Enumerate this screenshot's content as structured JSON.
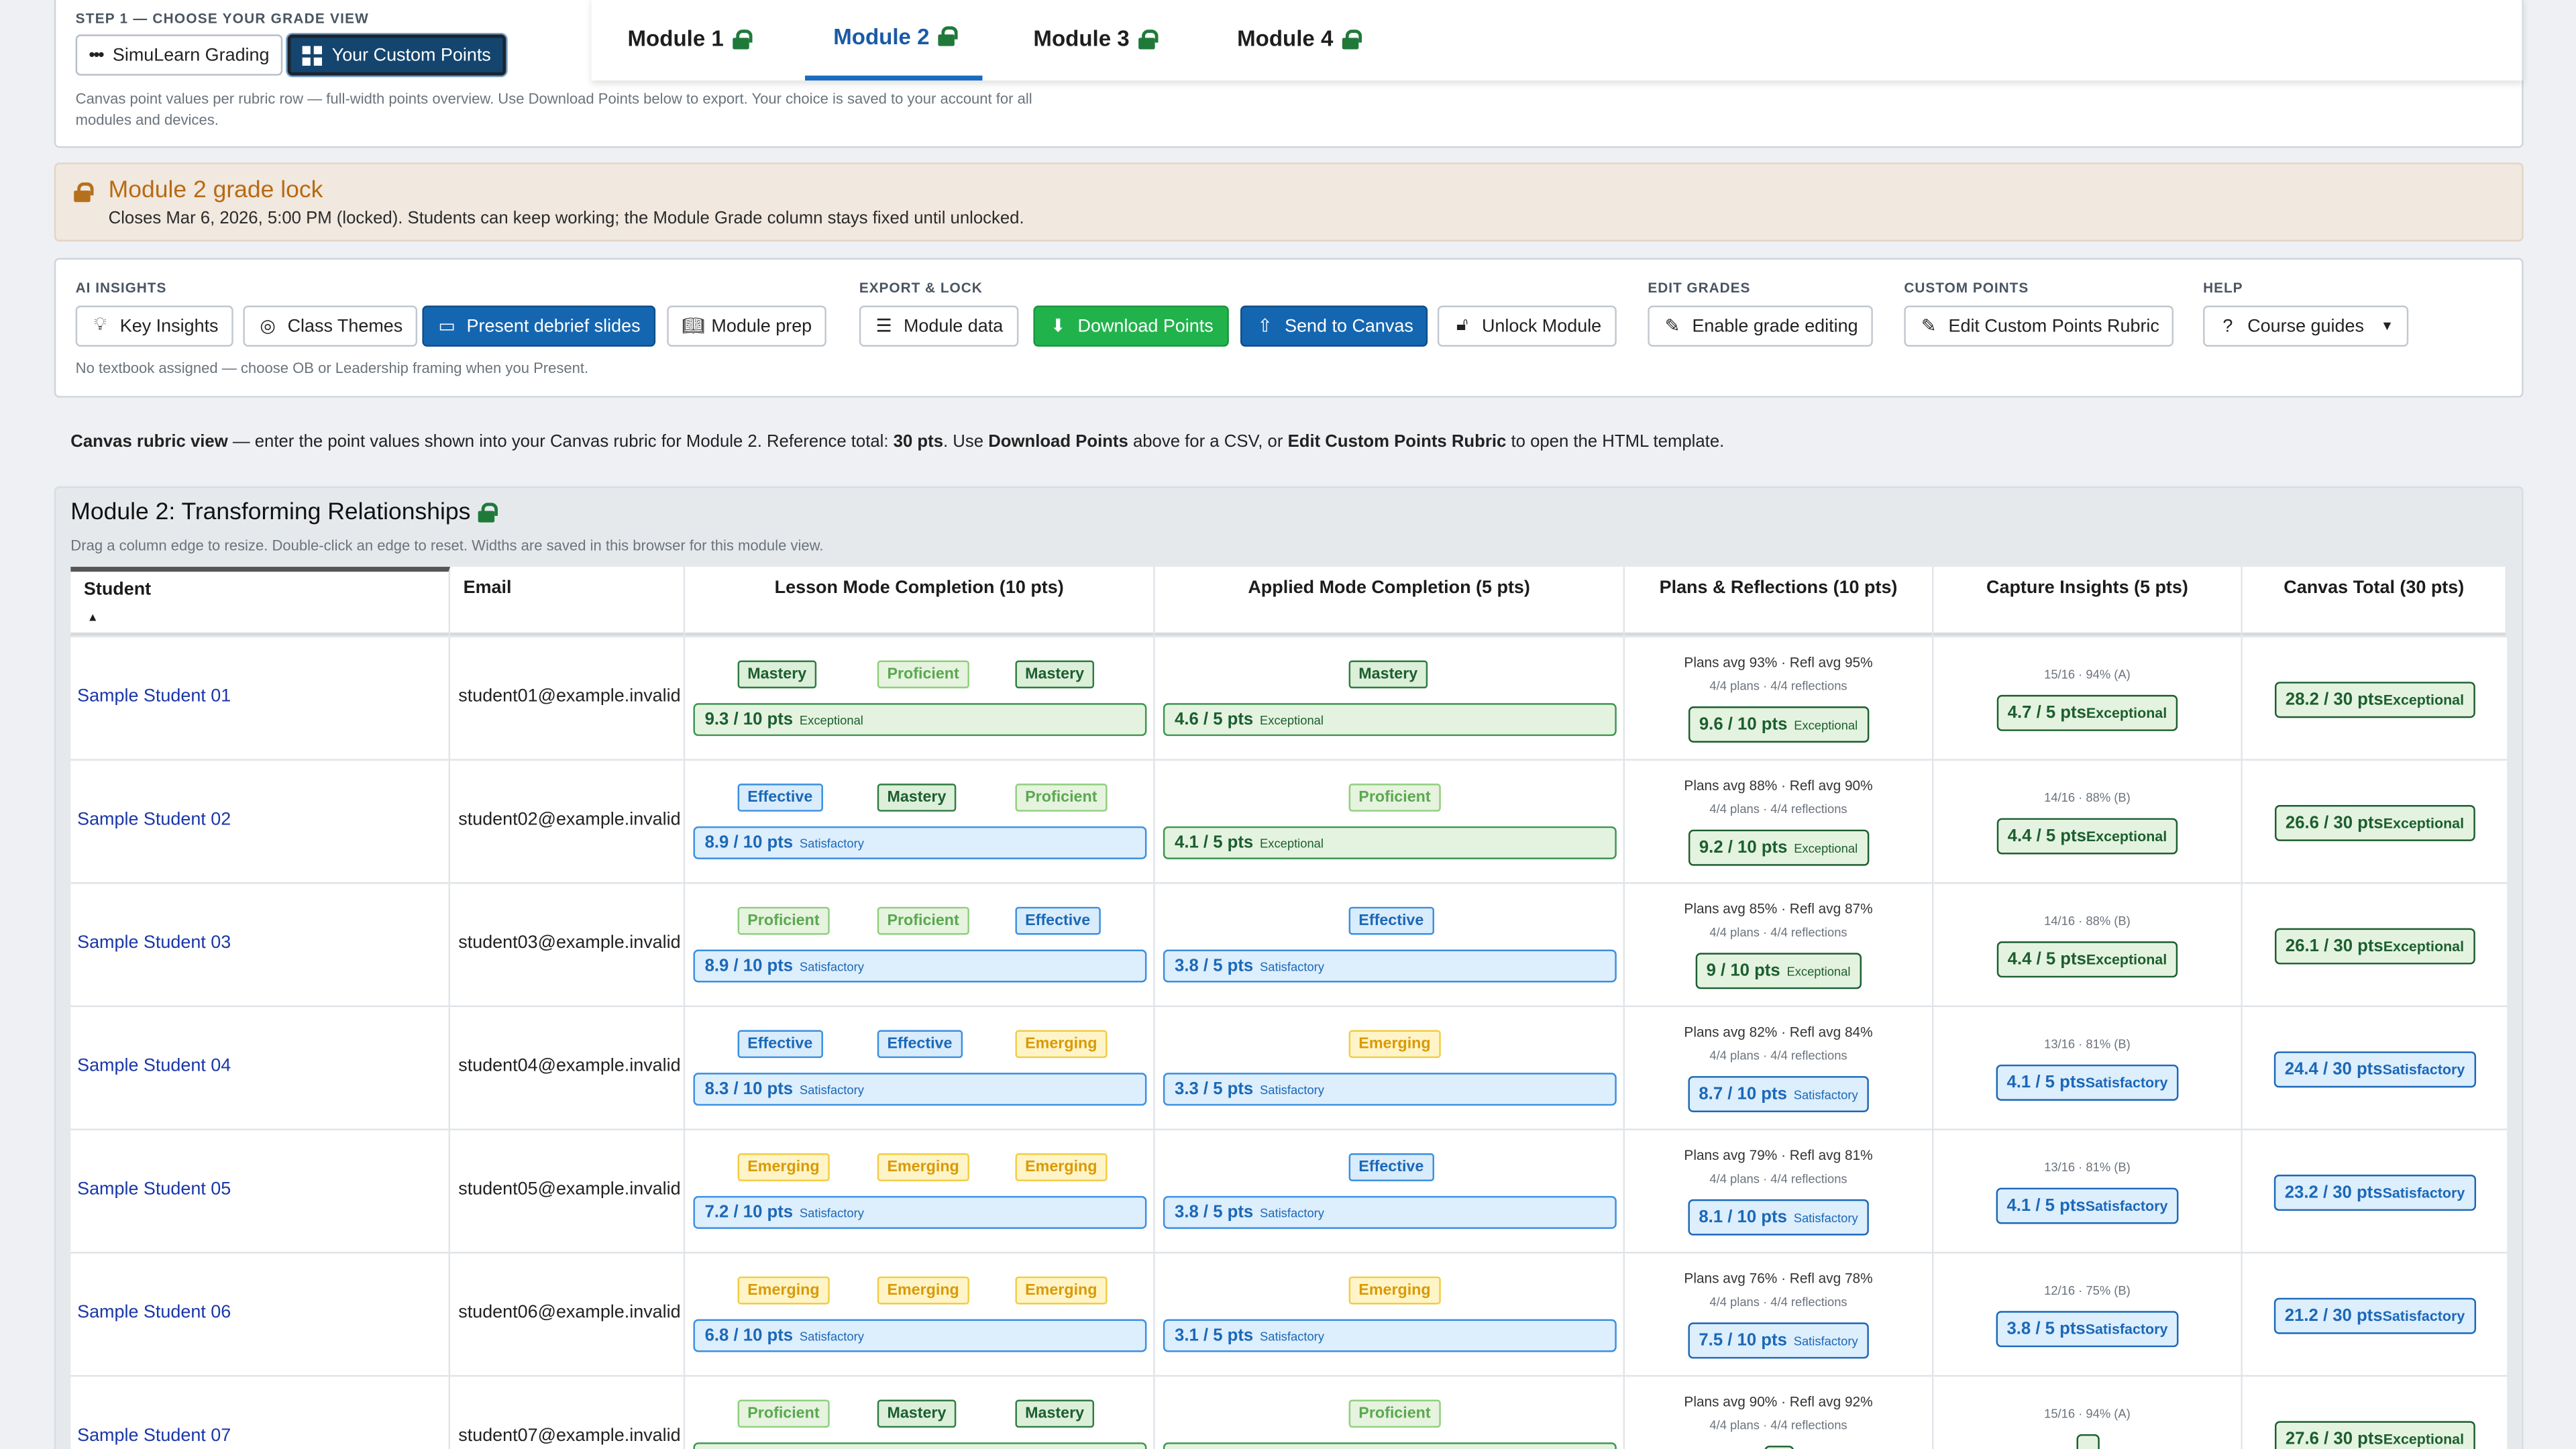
{
  "step": {
    "label": "STEP 1 — CHOOSE YOUR GRADE VIEW",
    "buttons": [
      {
        "label": "SimuLearn Grading",
        "icon": "dots-icon"
      },
      {
        "label": "Your Custom Points",
        "icon": "grid-icon",
        "selected": true
      }
    ],
    "desc": "Canvas point values per rubric row — full-width points overview. Use Download Points below to export. Your choice is saved to your account for all modules and devices."
  },
  "tabs": [
    {
      "label": "Module 1",
      "active": false
    },
    {
      "label": "Module 2",
      "active": true
    },
    {
      "label": "Module 3",
      "active": false
    },
    {
      "label": "Module 4",
      "active": false
    }
  ],
  "lock": {
    "title": "Module 2 grade lock",
    "desc": "Closes Mar 6, 2026, 5:00 PM (locked). Students can keep working; the Module Grade column stays fixed until unlocked."
  },
  "toolbar": {
    "groups": {
      "ai": "AI INSIGHTS",
      "export": "EXPORT & LOCK",
      "edit": "EDIT GRADES",
      "custom": "CUSTOM POINTS",
      "help": "HELP"
    },
    "buttons": {
      "key_insights": "Key Insights",
      "class_themes": "Class Themes",
      "present": "Present debrief slides",
      "module_prep": "Module prep",
      "module_data": "Module data",
      "download": "Download Points",
      "send": "Send to Canvas",
      "unlock": "Unlock Module",
      "enable_edit": "Enable grade editing",
      "edit_rubric": "Edit Custom Points Rubric",
      "guides": "Course guides"
    },
    "note": "No textbook assigned — choose OB or Leadership framing when you Present."
  },
  "info": {
    "p1": "Canvas rubric view",
    "p2": " — enter the point values shown into your Canvas rubric for Module 2. Reference total: ",
    "p3": "30 pts",
    "p4": ". Use ",
    "p5": "Download Points",
    "p6": " above for a CSV, or ",
    "p7": "Edit Custom Points Rubric",
    "p8": " to open the HTML template."
  },
  "module": {
    "title": "Module 2: Transforming Relationships",
    "hint": "Drag a column edge to resize. Double-click an edge to reset. Widths are saved in this browser for this module view."
  },
  "headers": {
    "student": "Student",
    "email": "Email",
    "lesson": "Lesson Mode Completion (10 pts)",
    "applied": "Applied Mode Completion (5 pts)",
    "plans": "Plans & Reflections (10 pts)",
    "capture": "Capture Insights (5 pts)",
    "total": "Canvas Total (30 pts)"
  },
  "rows": [
    {
      "name": "Sample Student 01",
      "email": "student01@example.invalid",
      "lesson_badges": [
        "Mastery",
        "Proficient",
        "Mastery"
      ],
      "lesson_pts": "9.3 / 10 pts",
      "lesson_tier": "Exceptional",
      "applied_badge": "Mastery",
      "applied_pts": "4.6 / 5 pts",
      "applied_tier": "Exceptional",
      "plans_avg": "Plans avg 93% · Refl avg 95%",
      "plans_counts": "4/4 plans · 4/4 reflections",
      "plans_pts": "9.6 / 10 pts",
      "plans_tier": "Exceptional",
      "capture_info": "15/16 · 94% (A)",
      "capture_pts": "4.7 / 5 pts",
      "capture_tier": "Exceptional",
      "total_pts": "28.2 / 30 pts",
      "total_tier": "Exceptional"
    },
    {
      "name": "Sample Student 02",
      "email": "student02@example.invalid",
      "lesson_badges": [
        "Effective",
        "Mastery",
        "Proficient"
      ],
      "lesson_pts": "8.9 / 10 pts",
      "lesson_tier": "Satisfactory",
      "applied_badge": "Proficient",
      "applied_pts": "4.1 / 5 pts",
      "applied_tier": "Exceptional",
      "plans_avg": "Plans avg 88% · Refl avg 90%",
      "plans_counts": "4/4 plans · 4/4 reflections",
      "plans_pts": "9.2 / 10 pts",
      "plans_tier": "Exceptional",
      "capture_info": "14/16 · 88% (B)",
      "capture_pts": "4.4 / 5 pts",
      "capture_tier": "Exceptional",
      "total_pts": "26.6 / 30 pts",
      "total_tier": "Exceptional"
    },
    {
      "name": "Sample Student 03",
      "email": "student03@example.invalid",
      "lesson_badges": [
        "Proficient",
        "Proficient",
        "Effective"
      ],
      "lesson_pts": "8.9 / 10 pts",
      "lesson_tier": "Satisfactory",
      "applied_badge": "Effective",
      "applied_pts": "3.8 / 5 pts",
      "applied_tier": "Satisfactory",
      "plans_avg": "Plans avg 85% · Refl avg 87%",
      "plans_counts": "4/4 plans · 4/4 reflections",
      "plans_pts": "9 / 10 pts",
      "plans_tier": "Exceptional",
      "capture_info": "14/16 · 88% (B)",
      "capture_pts": "4.4 / 5 pts",
      "capture_tier": "Exceptional",
      "total_pts": "26.1 / 30 pts",
      "total_tier": "Exceptional"
    },
    {
      "name": "Sample Student 04",
      "email": "student04@example.invalid",
      "lesson_badges": [
        "Effective",
        "Effective",
        "Emerging"
      ],
      "lesson_pts": "8.3 / 10 pts",
      "lesson_tier": "Satisfactory",
      "applied_badge": "Emerging",
      "applied_pts": "3.3 / 5 pts",
      "applied_tier": "Satisfactory",
      "plans_avg": "Plans avg 82% · Refl avg 84%",
      "plans_counts": "4/4 plans · 4/4 reflections",
      "plans_pts": "8.7 / 10 pts",
      "plans_tier": "Satisfactory",
      "capture_info": "13/16 · 81% (B)",
      "capture_pts": "4.1 / 5 pts",
      "capture_tier": "Satisfactory",
      "total_pts": "24.4 / 30 pts",
      "total_tier": "Satisfactory"
    },
    {
      "name": "Sample Student 05",
      "email": "student05@example.invalid",
      "lesson_badges": [
        "Emerging",
        "Emerging",
        "Emerging"
      ],
      "lesson_pts": "7.2 / 10 pts",
      "lesson_tier": "Satisfactory",
      "applied_badge": "Effective",
      "applied_pts": "3.8 / 5 pts",
      "applied_tier": "Satisfactory",
      "plans_avg": "Plans avg 79% · Refl avg 81%",
      "plans_counts": "4/4 plans · 4/4 reflections",
      "plans_pts": "8.1 / 10 pts",
      "plans_tier": "Satisfactory",
      "capture_info": "13/16 · 81% (B)",
      "capture_pts": "4.1 / 5 pts",
      "capture_tier": "Satisfactory",
      "total_pts": "23.2 / 30 pts",
      "total_tier": "Satisfactory"
    },
    {
      "name": "Sample Student 06",
      "email": "student06@example.invalid",
      "lesson_badges": [
        "Emerging",
        "Emerging",
        "Emerging"
      ],
      "lesson_pts": "6.8 / 10 pts",
      "lesson_tier": "Satisfactory",
      "applied_badge": "Emerging",
      "applied_pts": "3.1 / 5 pts",
      "applied_tier": "Satisfactory",
      "plans_avg": "Plans avg 76% · Refl avg 78%",
      "plans_counts": "4/4 plans · 4/4 reflections",
      "plans_pts": "7.5 / 10 pts",
      "plans_tier": "Satisfactory",
      "capture_info": "12/16 · 75% (B)",
      "capture_pts": "3.8 / 5 pts",
      "capture_tier": "Satisfactory",
      "total_pts": "21.2 / 30 pts",
      "total_tier": "Satisfactory"
    },
    {
      "name": "Sample Student 07",
      "email": "student07@example.invalid",
      "lesson_badges": [
        "Proficient",
        "Mastery",
        "Mastery"
      ],
      "lesson_pts": "",
      "lesson_tier": "",
      "applied_badge": "Proficient",
      "applied_pts": "",
      "applied_tier": "",
      "plans_avg": "Plans avg 90% · Refl avg 92%",
      "plans_counts": "4/4 plans · 4/4 reflections",
      "plans_pts": "",
      "plans_tier": "",
      "capture_info": "15/16 · 94% (A)",
      "capture_pts": "",
      "capture_tier": "",
      "total_pts": "27.6 / 30 pts",
      "total_tier": "Exceptional"
    }
  ]
}
